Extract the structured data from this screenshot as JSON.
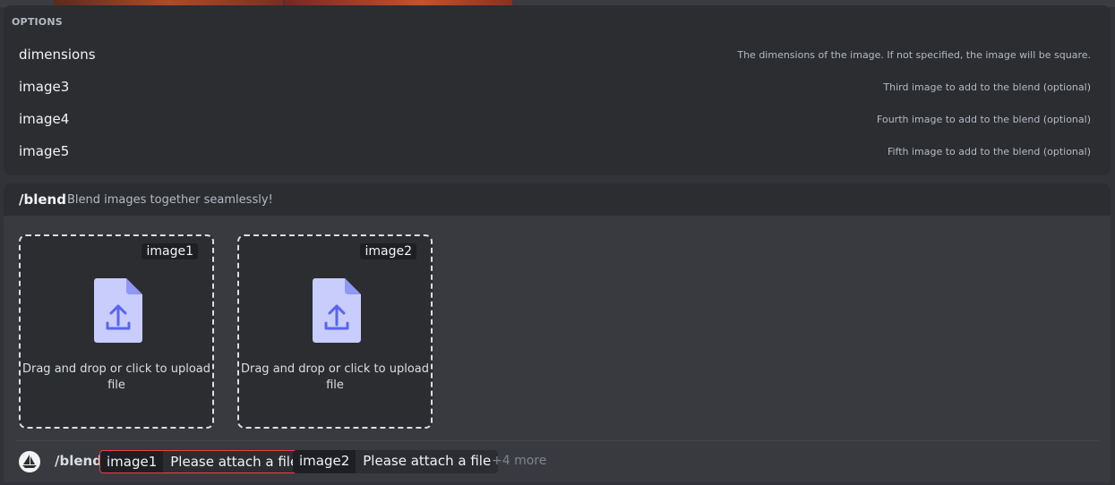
{
  "options": {
    "header": "OPTIONS",
    "items": [
      {
        "name": "dimensions",
        "description": "The dimensions of the image. If not specified, the image will be square."
      },
      {
        "name": "image3",
        "description": "Third image to add to the blend (optional)"
      },
      {
        "name": "image4",
        "description": "Fourth image to add to the blend (optional)"
      },
      {
        "name": "image5",
        "description": "Fifth image to add to the blend (optional)"
      }
    ]
  },
  "command": {
    "name": "/blend",
    "description": "Blend images together seamlessly!"
  },
  "uploads": [
    {
      "tag": "image1",
      "text": "Drag and drop or click to upload file"
    },
    {
      "tag": "image2",
      "text": "Drag and drop or click to upload file"
    }
  ],
  "input": {
    "command": "/blend",
    "params": [
      {
        "key": "image1",
        "value": "Please attach a file"
      },
      {
        "key": "image2",
        "value": "Please attach a file"
      }
    ],
    "more": "+4 more"
  },
  "colors": {
    "background": "#313338",
    "panel": "#2b2d31",
    "accent": "#5865f2",
    "file_icon": "#c9cdfb",
    "error": "#f23f43"
  },
  "icons": {
    "upload": "file-upload-icon",
    "avatar": "bot-avatar"
  }
}
